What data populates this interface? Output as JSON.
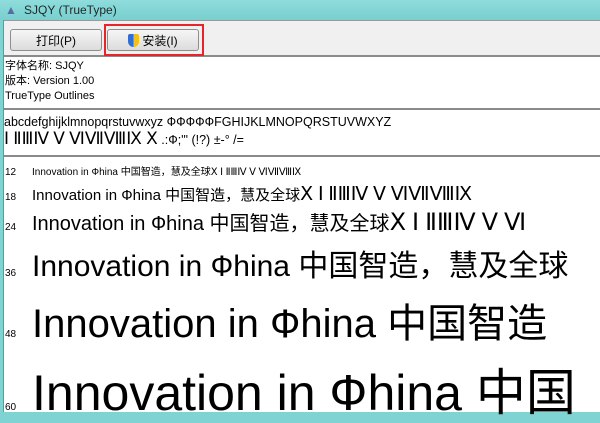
{
  "window": {
    "title": "SJQY (TrueType)",
    "app_icon": "font-viewer-icon",
    "accent_titlebar": "#7fd3d3",
    "highlight_color": "#e8242a"
  },
  "toolbar": {
    "print_label": "打印(P)",
    "install_label": "安装(I)",
    "install_icon": "uac-shield-icon"
  },
  "info": {
    "name": "字体名称: SJQY",
    "version": "版本: Version 1.00",
    "type": "TrueType Outlines"
  },
  "charset": {
    "line1": "abcdefghijklmnopqrstuvwxyz ФФФФФFGHIJKLMNOPQRSTUVWXYZ",
    "line2_roman": "Ⅰ ⅡⅢⅣ Ⅴ ⅥⅦⅧⅨ Ⅹ",
    "line2_rest": ".:Ф;'\" (!?) ±-° /="
  },
  "samples": [
    {
      "size": "12",
      "text": "Innovation in Фhina 中国智造，慧及全球",
      "roman": " Ⅹ Ⅰ ⅡⅢⅣ Ⅴ ⅥⅦⅧⅨ"
    },
    {
      "size": "18",
      "text": "Innovation in Фhina 中国智造，慧及全球",
      "roman": " Ⅹ Ⅰ ⅡⅢⅣ Ⅴ ⅥⅦⅧⅨ"
    },
    {
      "size": "24",
      "text": "Innovation in Фhina 中国智造，慧及全球",
      "roman": " Ⅹ Ⅰ ⅡⅢⅣ Ⅴ Ⅵ"
    },
    {
      "size": "36",
      "text": "Innovation in Фhina 中国智造，慧及全球",
      "roman": ""
    },
    {
      "size": "48",
      "text": "Innovation in Фhina 中国智造",
      "roman": ""
    },
    {
      "size": "60",
      "text": "Innovation in Фhina 中国",
      "roman": ""
    }
  ]
}
